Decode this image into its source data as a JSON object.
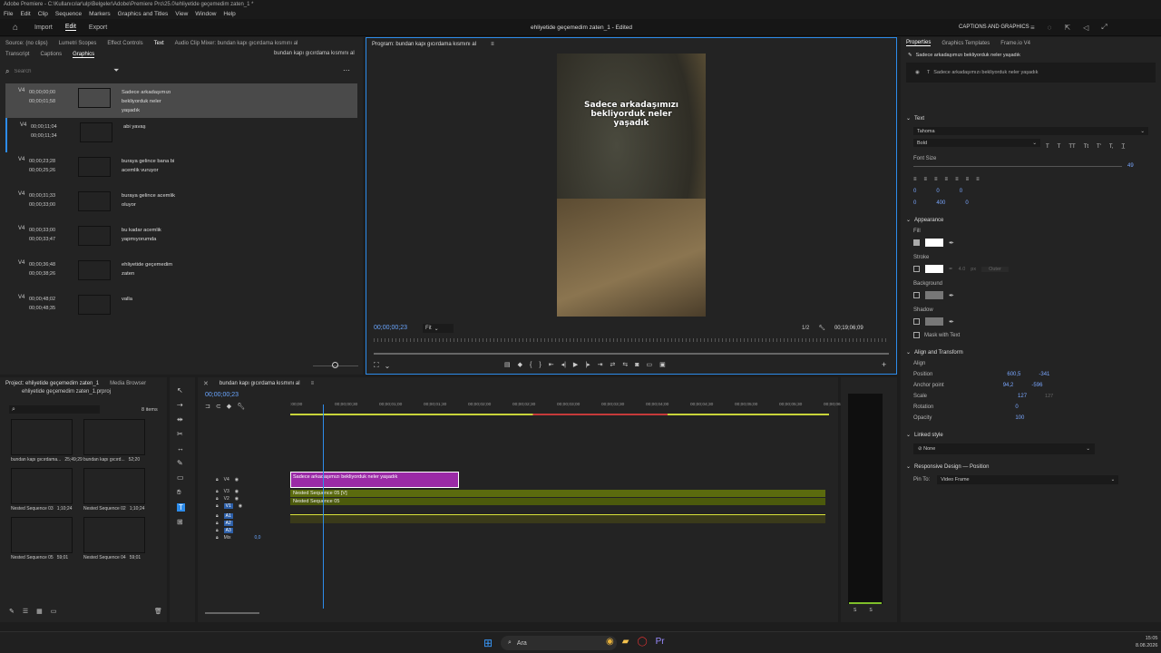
{
  "window": {
    "title": "Adobe Premiere - C:\\Kullanıcılar\\ulp\\Belgeler\\Adobe\\Premiere Pro\\25.0\\ehliyetide geçemedim zaten_1 *"
  },
  "menu": [
    "File",
    "Edit",
    "Clip",
    "Sequence",
    "Markers",
    "Graphics and Titles",
    "View",
    "Window",
    "Help"
  ],
  "appbar": {
    "tabs": [
      "Import",
      "Edit",
      "Export"
    ],
    "active": "Edit",
    "project_title": "ehliyetide geçemedim zaten_1 - Edited",
    "right_label": "CAPTIONS AND GRAPHICS"
  },
  "source_panel": {
    "tabs": [
      "Source: (no clips)",
      "Lumetri Scopes",
      "Effect Controls",
      "Text",
      "Audio Clip Mixer: bundan kapı gıcırdama kısmını al"
    ],
    "subtabs": [
      "Transcript",
      "Captions",
      "Graphics"
    ],
    "active_subtab": "Graphics",
    "sequence_name": "bundan kapı gıcırdama kısmını al",
    "search_placeholder": "Search",
    "captions": [
      {
        "track": "V4",
        "in": "00;00;00;00",
        "out": "00;00;01;58",
        "text": "Sadece arkadaşımızı bekliyorduk neler yaşadık"
      },
      {
        "track": "V4",
        "in": "00;00;11;04",
        "out": "00;00;11;34",
        "text": "abi yavaş"
      },
      {
        "track": "V4",
        "in": "00;00;23;28",
        "out": "00;00;25;26",
        "text": "buraya gelince bana bi acemlik vuruyor"
      },
      {
        "track": "V4",
        "in": "00;00;31;33",
        "out": "00;00;33;00",
        "text": "buraya gelince acemlik oluyor"
      },
      {
        "track": "V4",
        "in": "00;00;33;00",
        "out": "00;00;33;47",
        "text": "bu kadar acemlik yapmıyorumda"
      },
      {
        "track": "V4",
        "in": "00;00;36;48",
        "out": "00;00;38;26",
        "text": "ehliyetide geçemedim zaten"
      },
      {
        "track": "V4",
        "in": "00;00;48;02",
        "out": "00;00;48;35",
        "text": "valla"
      }
    ]
  },
  "program": {
    "tab": "Program: bundan kapı gıcırdama kısmını al",
    "caption_text": "Sadece arkadaşımızı bekliyorduk neler yaşadık",
    "timecode": "00;00;00;23",
    "fit": "Fit",
    "resolution": "1/2",
    "duration": "00;19;06;09"
  },
  "project": {
    "tabs": [
      "Project: ehliyetide geçemedim zaten_1",
      "Media Browser"
    ],
    "file": "ehliyetide geçemedim zaten_1.prproj",
    "item_count": "8 items",
    "items": [
      {
        "name": "bundan kapı gıcırdama...",
        "dur": "25;49;29"
      },
      {
        "name": "bundan kapı gıcırd...",
        "dur": "52;20"
      },
      {
        "name": "Nested Sequence 03",
        "dur": "1;10;24"
      },
      {
        "name": "Nested Sequence 02",
        "dur": "1;10;24"
      },
      {
        "name": "Nested Sequence 05",
        "dur": "59;01"
      },
      {
        "name": "Nested Sequence 04",
        "dur": "59;01"
      }
    ]
  },
  "timeline": {
    "tab": "bundan kapı gıcırdama kısmını al",
    "timecode": "00;00;00;23",
    "ruler": [
      ":00;00",
      "00;00;00;30",
      "00;00;01;00",
      "00;00;01;30",
      "00;00;02;00",
      "00;00;02;30",
      "00;00;03;00",
      "00;00;03;30",
      "00;00;04;00",
      "00;00;04;30",
      "00;00;05;00",
      "00;00;05;30",
      "00;00;06;00"
    ],
    "video_tracks": [
      "V4",
      "V3",
      "V2",
      "V1"
    ],
    "audio_tracks": [
      "A1",
      "A2",
      "A3",
      "Mix"
    ],
    "mix_value": "0,0",
    "clips": {
      "caption_clip": "Sadece arkadaşımızı bekliyorduk neler yaşadık",
      "v3_clip": "Nested Sequence 05 [V]",
      "v2_clip": "Nested Sequence 05"
    },
    "meter_labels": [
      "S",
      "S"
    ]
  },
  "properties": {
    "tabs": [
      "Properties",
      "Graphics Templates",
      "Frame.io V4"
    ],
    "layer_title": "Sadece arkadaşımızı bekliyorduk neler yaşadık",
    "layer_item": "Sadece arkadaşımızı bekliyorduk neler yaşadık",
    "text_section": "Text",
    "font": "Tahoma",
    "style": "Bold",
    "font_size_label": "Font Size",
    "font_size": "49",
    "tracking": "0",
    "kerning": "0",
    "leading": "0",
    "baseline": "0",
    "tsume": "0",
    "width": "400",
    "indent": "0",
    "appearance_section": "Appearance",
    "fill_label": "Fill",
    "stroke_label": "Stroke",
    "stroke_width": "4.0",
    "stroke_unit": "px",
    "stroke_type": "Outer",
    "background_label": "Background",
    "shadow_label": "Shadow",
    "mask_label": "Mask with Text",
    "align_section": "Align and Transform",
    "align_label": "Align",
    "position_label": "Position",
    "position_x": "600,5",
    "position_y": "-341",
    "anchor_label": "Anchor point",
    "anchor_x": "94,2",
    "anchor_y": "-596",
    "scale_label": "Scale",
    "scale": "127",
    "scale2": "127",
    "rotation_label": "Rotation",
    "rotation": "0",
    "opacity_label": "Opacity",
    "opacity": "100",
    "linked_section": "Linked style",
    "linked_value": "None",
    "responsive_section": "Responsive Design — Position",
    "pin_label": "Pin To:",
    "pin_value": "Video Frame",
    "colors": {
      "fill": "#ffffff",
      "stroke": "#ffffff",
      "accent": "#2d8ceb",
      "caption_clip": "#9a2aa6",
      "video_clip": "#5b6b0e"
    }
  },
  "taskbar": {
    "search": "Ara",
    "time": "15:05",
    "date": "8.08.2026"
  }
}
